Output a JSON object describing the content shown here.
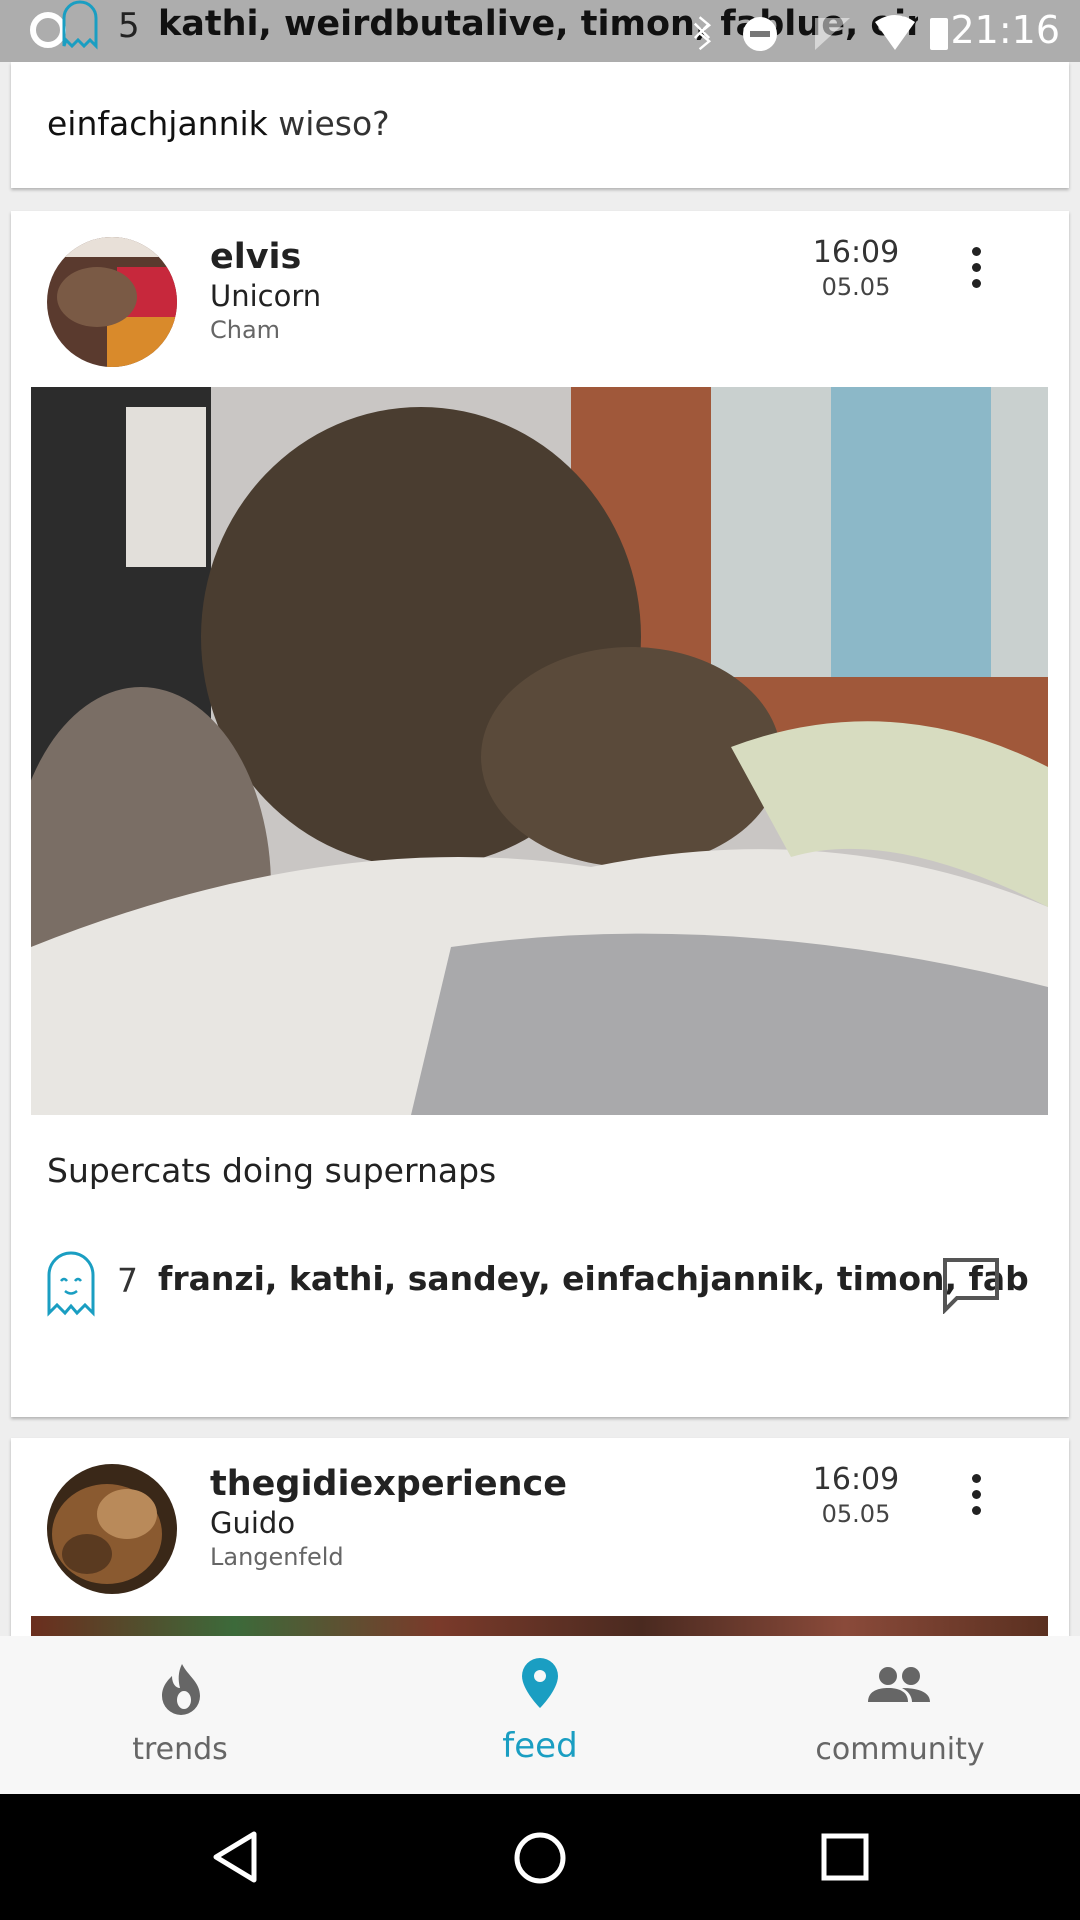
{
  "status_bar": {
    "likes_count": "5",
    "likers": "kathi, weirdbutalive, timon, fablue, einfachjannik",
    "time": "21:16"
  },
  "top_comment": {
    "author": "einfachjannik",
    "text": "wieso?"
  },
  "posts": [
    {
      "username": "elvis",
      "display_name": "Unicorn",
      "location": "Cham",
      "time": "16:09",
      "date": "05.05",
      "caption": "Supercats doing supernaps",
      "likes_count": "7",
      "likers": "franzi, kathi, sandey, einfachjannik, timon, fab"
    },
    {
      "username": "thegidiexperience",
      "display_name": "Guido",
      "location": "Langenfeld",
      "time": "16:09",
      "date": "05.05"
    }
  ],
  "bottom_nav": {
    "items": [
      {
        "label": "trends",
        "icon": "flame-icon"
      },
      {
        "label": "feed",
        "icon": "location-pin-icon"
      },
      {
        "label": "community",
        "icon": "people-icon"
      }
    ],
    "active": "feed",
    "accent_color": "#1a9ec2",
    "inactive_color": "#666666"
  },
  "system_nav": {
    "icons": [
      "back-icon",
      "home-icon",
      "recents-icon"
    ]
  }
}
